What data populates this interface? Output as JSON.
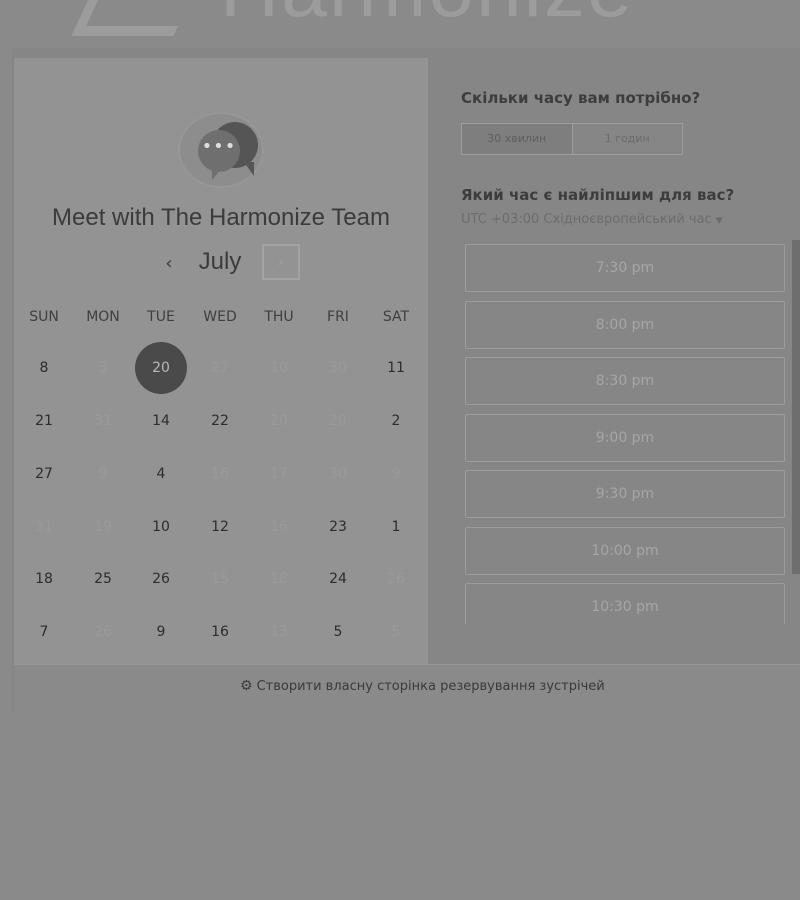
{
  "brand": {
    "logo_text": "Harmonize"
  },
  "calendar": {
    "team_title": "Meet with The Harmonize Team",
    "month": "July",
    "prev_icon": "‹",
    "next_icon": "›",
    "weekdays": [
      "SUN",
      "MON",
      "TUE",
      "WED",
      "THU",
      "FRI",
      "SAT"
    ],
    "rows": [
      [
        {
          "d": "8",
          "s": "on"
        },
        {
          "d": "3",
          "s": "off"
        },
        {
          "d": "20",
          "s": "selected"
        },
        {
          "d": "27",
          "s": "off"
        },
        {
          "d": "10",
          "s": "off"
        },
        {
          "d": "30",
          "s": "off"
        },
        {
          "d": "11",
          "s": "on"
        }
      ],
      [
        {
          "d": "21",
          "s": "on"
        },
        {
          "d": "31",
          "s": "off"
        },
        {
          "d": "14",
          "s": "on"
        },
        {
          "d": "22",
          "s": "on"
        },
        {
          "d": "20",
          "s": "off"
        },
        {
          "d": "20",
          "s": "off"
        },
        {
          "d": "2",
          "s": "on"
        }
      ],
      [
        {
          "d": "27",
          "s": "on"
        },
        {
          "d": "9",
          "s": "off"
        },
        {
          "d": "4",
          "s": "on"
        },
        {
          "d": "16",
          "s": "off"
        },
        {
          "d": "17",
          "s": "off"
        },
        {
          "d": "30",
          "s": "off"
        },
        {
          "d": "9",
          "s": "off"
        }
      ],
      [
        {
          "d": "31",
          "s": "off"
        },
        {
          "d": "19",
          "s": "off"
        },
        {
          "d": "10",
          "s": "on"
        },
        {
          "d": "12",
          "s": "on"
        },
        {
          "d": "16",
          "s": "off"
        },
        {
          "d": "23",
          "s": "on"
        },
        {
          "d": "1",
          "s": "on"
        }
      ],
      [
        {
          "d": "18",
          "s": "on"
        },
        {
          "d": "25",
          "s": "on"
        },
        {
          "d": "26",
          "s": "on"
        },
        {
          "d": "15",
          "s": "off"
        },
        {
          "d": "18",
          "s": "off"
        },
        {
          "d": "24",
          "s": "on"
        },
        {
          "d": "26",
          "s": "off"
        }
      ],
      [
        {
          "d": "7",
          "s": "on"
        },
        {
          "d": "26",
          "s": "off"
        },
        {
          "d": "9",
          "s": "on"
        },
        {
          "d": "16",
          "s": "on"
        },
        {
          "d": "13",
          "s": "off"
        },
        {
          "d": "5",
          "s": "on"
        },
        {
          "d": "5",
          "s": "off"
        }
      ]
    ]
  },
  "booking": {
    "duration_question": "Скільки часу вам потрібно?",
    "durations": [
      "30 хвилин",
      "1 годин"
    ],
    "time_question": "Який час є найліпшим для вас?",
    "timezone": "UTC +03:00 Східноєвропейський час",
    "timezone_caret": "▼",
    "slots": [
      "7:30 pm",
      "8:00 pm",
      "8:30 pm",
      "9:00 pm",
      "9:30 pm",
      "10:00 pm",
      "10:30 pm"
    ]
  },
  "footer": {
    "icon": "hubspot-icon",
    "link_text": "Створити власну сторінка резервування зустрічей"
  }
}
